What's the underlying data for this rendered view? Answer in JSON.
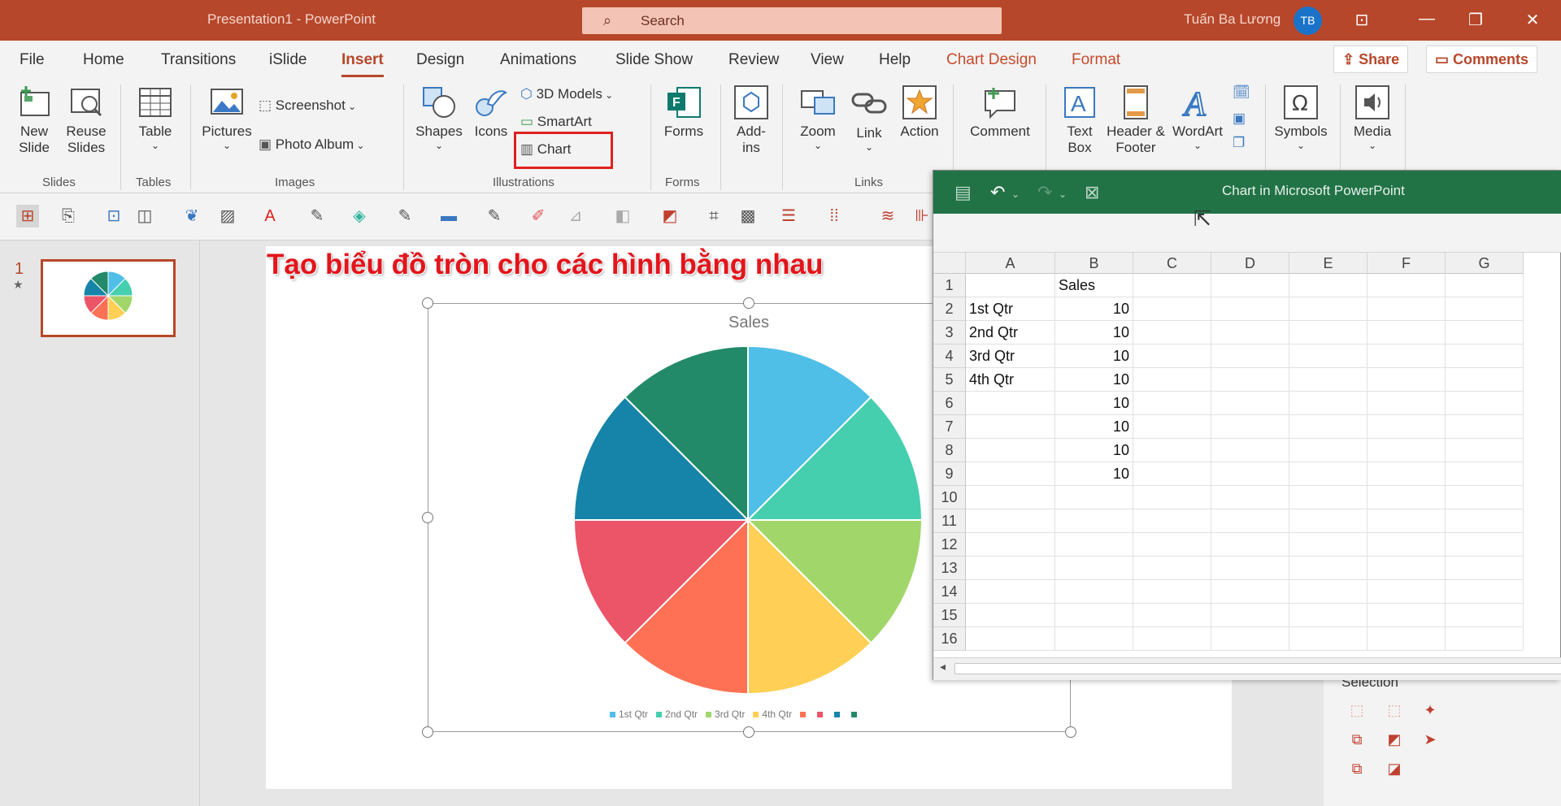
{
  "window": {
    "title": "Presentation1  -  PowerPoint",
    "search_placeholder": "Search",
    "user_name": "Tuấn Ba Lương",
    "user_initials": "TB"
  },
  "tabs": [
    "File",
    "Home",
    "Transitions",
    "iSlide",
    "Insert",
    "Design",
    "Animations",
    "Slide Show",
    "Review",
    "View",
    "Help",
    "Chart Design",
    "Format"
  ],
  "active_tab": "Insert",
  "actions": {
    "share": "Share",
    "comments": "Comments"
  },
  "ribbon": {
    "new_slide": "New Slide",
    "reuse_slides": "Reuse Slides",
    "table": "Table",
    "pictures": "Pictures",
    "screenshot": "Screenshot",
    "photo_album": "Photo Album",
    "shapes": "Shapes",
    "icons": "Icons",
    "models_3d": "3D Models",
    "smartart": "SmartArt",
    "chart": "Chart",
    "forms": "Forms",
    "addins": "Add-ins",
    "zoom": "Zoom",
    "link": "Link",
    "action": "Action",
    "comment": "Comment",
    "text_box": "Text Box",
    "header_footer": "Header & Footer",
    "wordart": "WordArt",
    "symbols": "Symbols",
    "media": "Media",
    "groups": {
      "slides": "Slides",
      "tables": "Tables",
      "images": "Images",
      "illustrations": "Illustrations",
      "forms": "Forms",
      "links": "Links"
    }
  },
  "thumbnail": {
    "number": "1"
  },
  "slide": {
    "heading": "Tạo biểu đồ tròn cho các hình bằng nhau"
  },
  "chart_data": {
    "type": "pie",
    "title": "Sales",
    "categories": [
      "1st Qtr",
      "2nd Qtr",
      "3rd Qtr",
      "4th Qtr",
      "",
      "",
      "",
      ""
    ],
    "values": [
      10,
      10,
      10,
      10,
      10,
      10,
      10,
      10
    ],
    "colors": [
      "#4fbfe7",
      "#46cfaf",
      "#a1d66a",
      "#ffd055",
      "#ff7154",
      "#ec5468",
      "#1684a8",
      "#228a69"
    ],
    "legend_position": "bottom"
  },
  "excel": {
    "caption": "Chart in Microsoft PowerPoint",
    "columns": [
      "A",
      "B",
      "C",
      "D",
      "E",
      "F",
      "G"
    ],
    "rows": [
      [
        "",
        "Sales"
      ],
      [
        "1st Qtr",
        "10"
      ],
      [
        "2nd Qtr",
        "10"
      ],
      [
        "3rd Qtr",
        "10"
      ],
      [
        "4th Qtr",
        "10"
      ],
      [
        "",
        "10"
      ],
      [
        "",
        "10"
      ],
      [
        "",
        "10"
      ],
      [
        "",
        "10"
      ],
      [
        "",
        ""
      ],
      [
        "",
        ""
      ],
      [
        "",
        ""
      ],
      [
        "",
        ""
      ],
      [
        "",
        ""
      ],
      [
        "",
        ""
      ],
      [
        "",
        ""
      ]
    ]
  },
  "selection_pane": {
    "title": "Selection"
  }
}
